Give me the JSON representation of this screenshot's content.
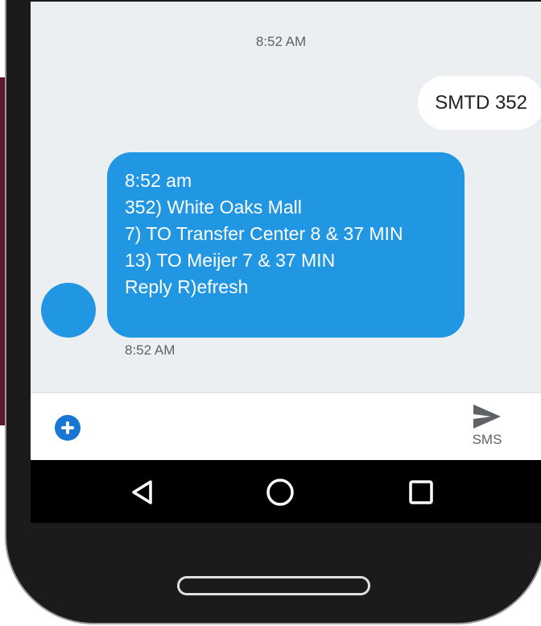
{
  "messages": {
    "top_timestamp": "8:52 AM",
    "outgoing_text": "SMTD 352",
    "incoming_text": "8:52 am\n352) White Oaks Mall\n7) TO Transfer Center 8 & 37 MIN\n13) TO Meijer 7 & 37 MIN\nReply R)efresh",
    "incoming_timestamp": "8:52 AM"
  },
  "composer": {
    "add_icon": "plus-circle-icon",
    "send_icon": "send-icon",
    "send_label": "SMS"
  },
  "nav": {
    "back_icon": "triangle-back-icon",
    "home_icon": "circle-home-icon",
    "recent_icon": "square-recent-icon"
  },
  "colors": {
    "bubble_incoming": "#2196e3",
    "bubble_outgoing": "#ffffff",
    "chat_background": "#eceff1",
    "add_button": "#1976d2"
  }
}
